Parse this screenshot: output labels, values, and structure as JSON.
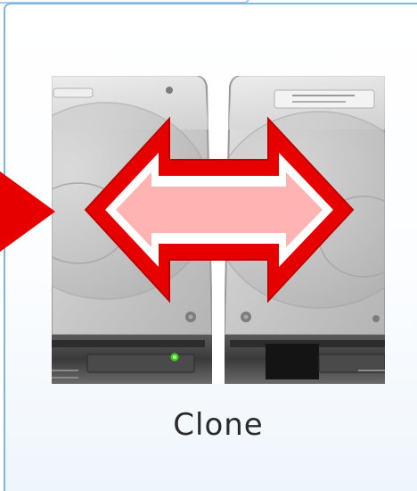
{
  "tile": {
    "label": "Clone",
    "icon": "clone-disks-icon",
    "accent_border": "#7fb6e0"
  },
  "arrow": {
    "color": "#e60000",
    "highlight_color": "#ffb3b3"
  },
  "led_color": "#3cd21e"
}
